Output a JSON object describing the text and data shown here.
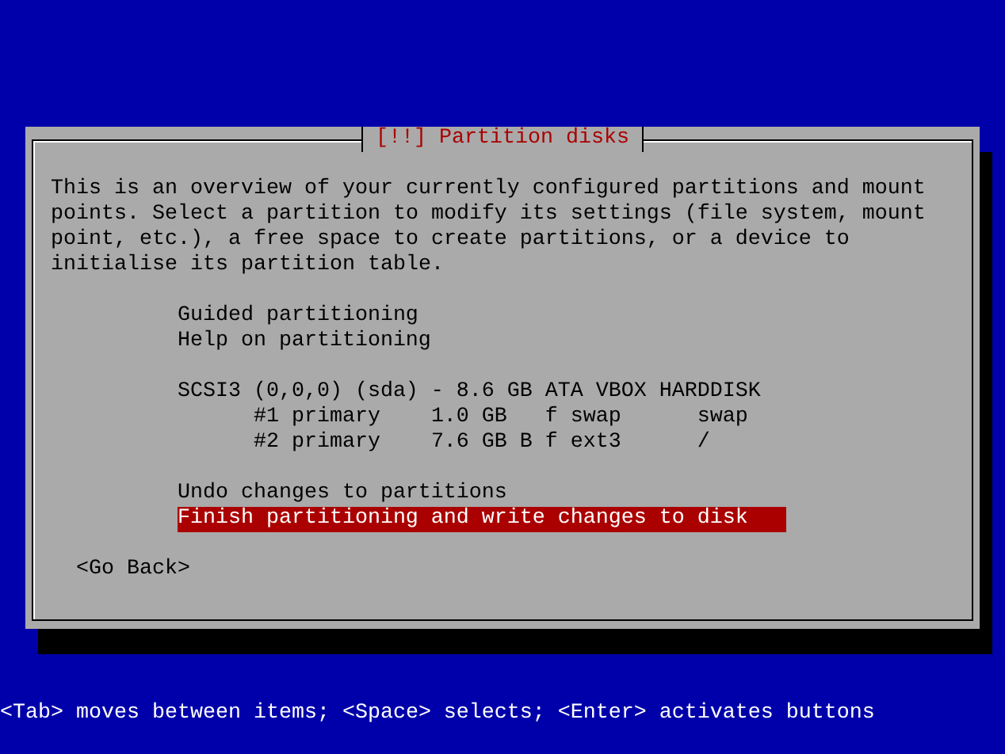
{
  "dialog": {
    "title": "[!!] Partition disks",
    "description": "This is an overview of your currently configured partitions and mount points. Select a partition to modify its settings (file system, mount point, etc.), a free space to create partitions, or a device to initialise its partition table.",
    "menu": [
      {
        "kind": "action",
        "label": "Guided partitioning",
        "selected": false
      },
      {
        "kind": "action",
        "label": "Help on partitioning",
        "selected": false
      },
      {
        "kind": "disk",
        "label": "SCSI3 (0,0,0) (sda) - 8.6 GB ATA VBOX HARDDISK",
        "selected": false
      },
      {
        "kind": "partition",
        "number": "#1 primary",
        "size": "1.0 GB",
        "flags": "f",
        "filesystem": "swap",
        "mount": "swap",
        "selected": false
      },
      {
        "kind": "partition",
        "number": "#2 primary",
        "size": "7.6 GB",
        "flags": "B f",
        "filesystem": "ext3",
        "mount": "/",
        "selected": false
      },
      {
        "kind": "action",
        "label": "Undo changes to partitions",
        "selected": false
      },
      {
        "kind": "action",
        "label": "Finish partitioning and write changes to disk",
        "selected": true
      }
    ],
    "buttons": [
      {
        "label": "<Go Back>",
        "selected": false
      }
    ]
  },
  "status_bar": "<Tab> moves between items; <Space> selects; <Enter> activates buttons"
}
